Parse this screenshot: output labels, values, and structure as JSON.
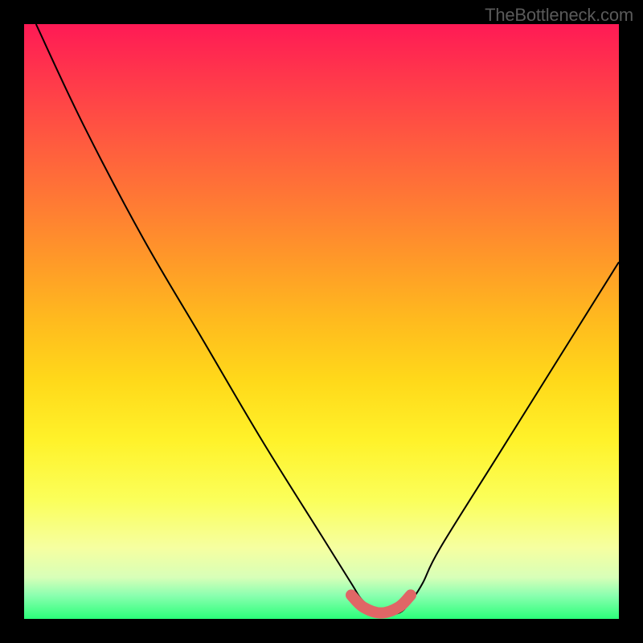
{
  "watermark": "TheBottleneck.com",
  "chart_data": {
    "type": "line",
    "title": "",
    "xlabel": "",
    "ylabel": "",
    "xlim": [
      0,
      100
    ],
    "ylim": [
      0,
      100
    ],
    "series": [
      {
        "name": "curve",
        "x": [
          2,
          10,
          20,
          30,
          40,
          50,
          55,
          57,
          60,
          63,
          65,
          67,
          70,
          80,
          90,
          100
        ],
        "values": [
          100,
          83,
          64,
          47,
          30,
          14,
          6,
          3,
          1,
          1,
          3,
          6,
          12,
          28,
          44,
          60
        ]
      },
      {
        "name": "highlight-band",
        "x": [
          55,
          57,
          60,
          63,
          65
        ],
        "values": [
          4,
          2,
          1,
          2,
          4
        ]
      }
    ]
  }
}
